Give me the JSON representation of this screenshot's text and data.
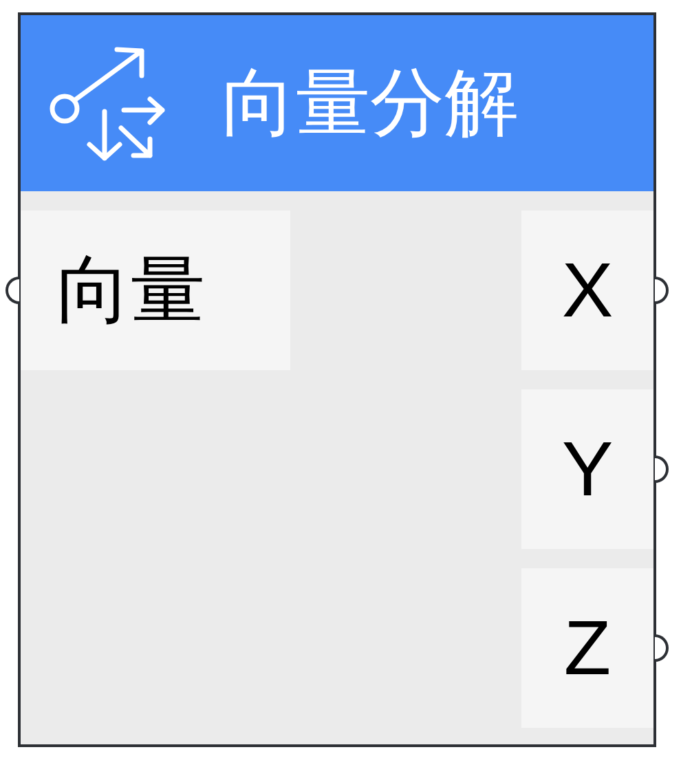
{
  "node": {
    "title": "向量分解"
  },
  "inputs": [
    {
      "label": "向量"
    }
  ],
  "outputs": [
    {
      "label": "X"
    },
    {
      "label": "Y"
    },
    {
      "label": "Z"
    }
  ]
}
